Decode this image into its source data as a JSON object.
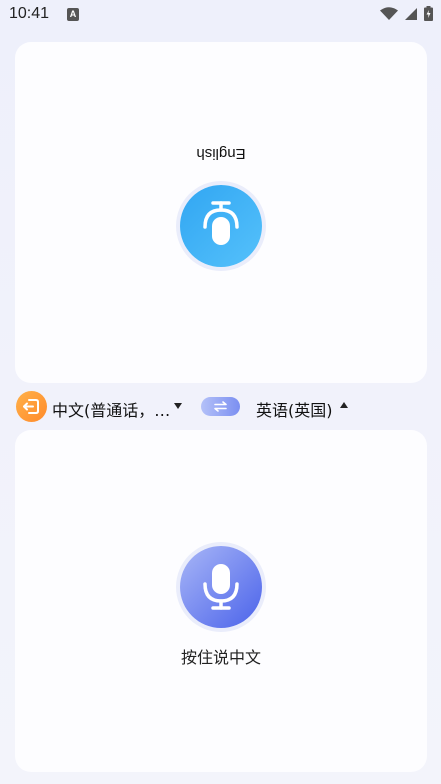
{
  "status_bar": {
    "time": "10:41",
    "notification_icon_letter": "A",
    "icons": [
      "wifi-icon",
      "signal-icon",
      "battery-icon"
    ]
  },
  "top_panel": {
    "language_label": "English",
    "mic_icon": "mic-icon",
    "accent": "#3aaef5"
  },
  "language_bar": {
    "source_language": "中文(普通话，…",
    "target_language": "英语(英国)",
    "exit_icon": "exit-icon",
    "swap_icon": "swap-icon"
  },
  "bottom_panel": {
    "hint": "按住说中文",
    "mic_icon": "mic-icon",
    "accent": "#5a6fee"
  }
}
